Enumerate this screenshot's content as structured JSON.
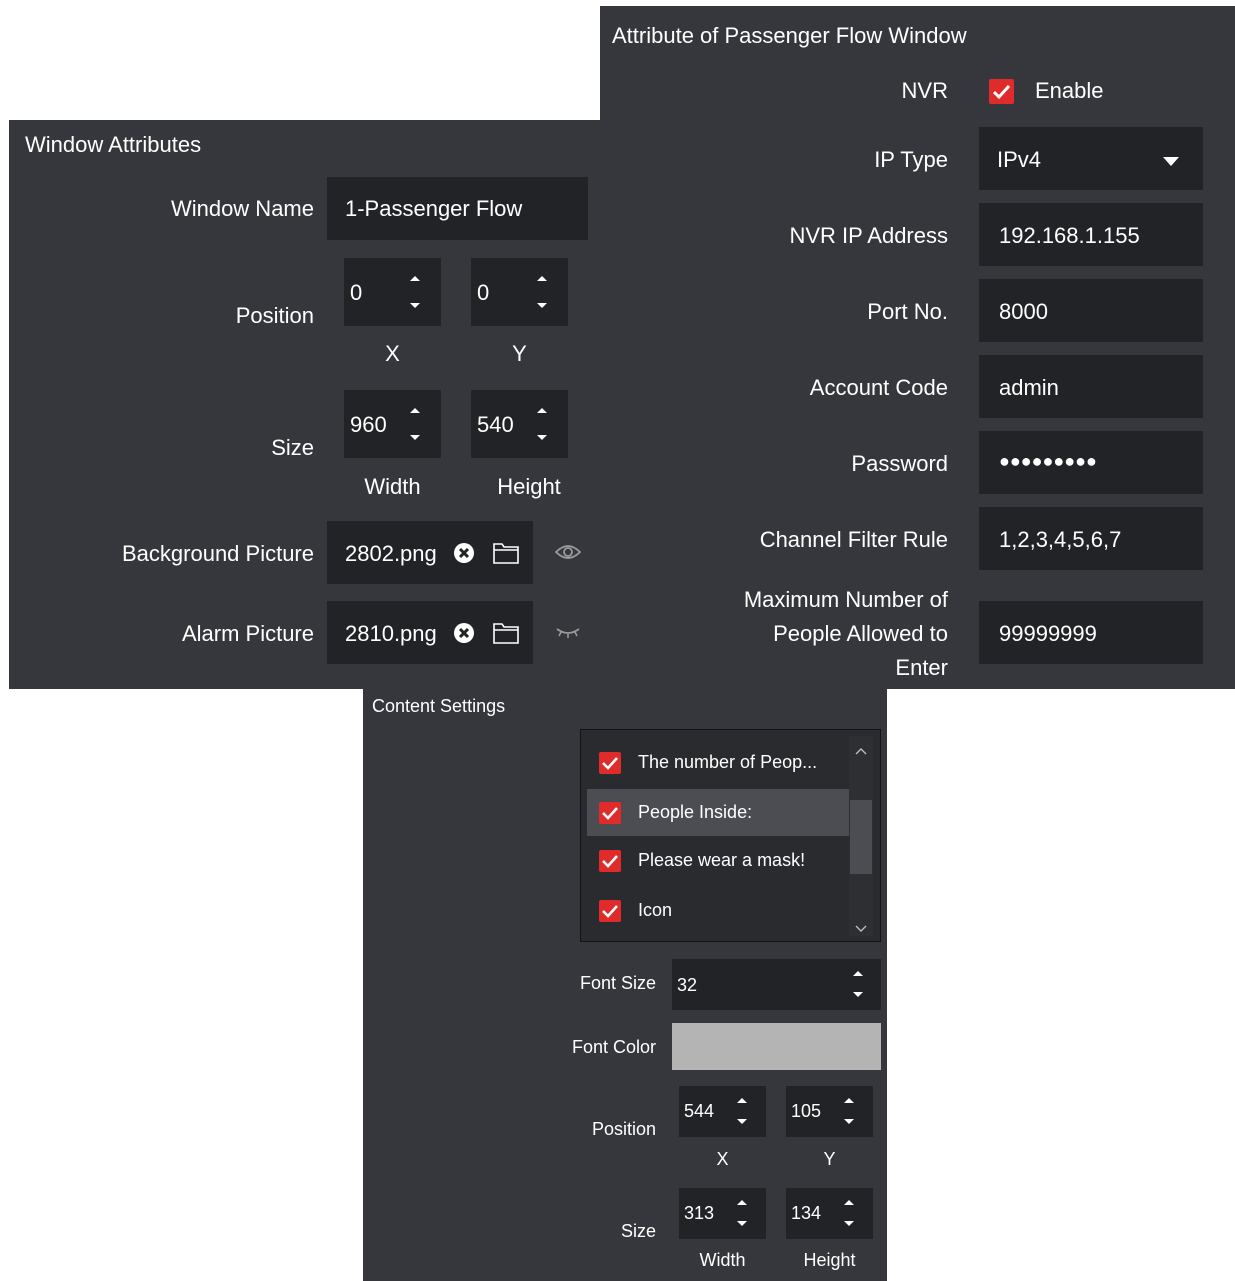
{
  "window_attributes": {
    "title": "Window Attributes",
    "window_name_label": "Window Name",
    "window_name_value": "1-Passenger Flow",
    "position_label": "Position",
    "position_x": "0",
    "position_y": "0",
    "x_caption": "X",
    "y_caption": "Y",
    "size_label": "Size",
    "size_width": "960",
    "size_height": "540",
    "width_caption": "Width",
    "height_caption": "Height",
    "background_label": "Background Picture",
    "background_value": "2802.png",
    "alarm_label": "Alarm Picture",
    "alarm_value": "2810.png"
  },
  "passenger_flow": {
    "title": "Attribute of Passenger Flow Window",
    "nvr_label": "NVR",
    "enable_label": "Enable",
    "enable_checked": true,
    "ip_type_label": "IP Type",
    "ip_type_value": "IPv4",
    "nvr_ip_label": "NVR IP Address",
    "nvr_ip_value": "192.168.1.155",
    "port_label": "Port No.",
    "port_value": "8000",
    "account_label": "Account Code",
    "account_value": "admin",
    "password_label": "Password",
    "password_value": "●●●●●●●●●",
    "channel_label": "Channel Filter Rule",
    "channel_value": "1,2,3,4,5,6,7",
    "max_people_label_1": "Maximum Number of",
    "max_people_label_2": "People Allowed to",
    "max_people_label_3": "Enter",
    "max_people_value": "99999999"
  },
  "content_settings": {
    "title": "Content Settings",
    "items": [
      {
        "label": "The number of Peop...",
        "checked": true
      },
      {
        "label": "People Inside:",
        "checked": true
      },
      {
        "label": "Please wear a mask!",
        "checked": true
      },
      {
        "label": "Icon",
        "checked": true
      }
    ],
    "font_size_label": "Font Size",
    "font_size_value": "32",
    "font_color_label": "Font Color",
    "font_color_value": "#b4b4b4",
    "position_label": "Position",
    "position_x": "544",
    "position_y": "105",
    "x_caption": "X",
    "y_caption": "Y",
    "size_label": "Size",
    "size_width": "313",
    "size_height": "134",
    "width_caption": "Width",
    "height_caption": "Height"
  },
  "colors": {
    "panel_bg": "#35373c",
    "field_bg": "#222327",
    "accent_red": "#e02b2b"
  }
}
